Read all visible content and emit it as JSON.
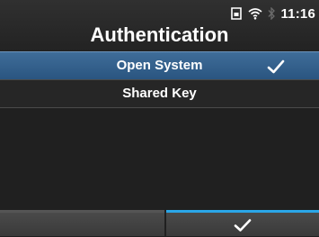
{
  "status_bar": {
    "time": "11:16",
    "icons": [
      "sd-card-icon",
      "wifi-icon",
      "bluetooth-icon"
    ]
  },
  "page": {
    "title": "Authentication"
  },
  "options": [
    {
      "label": "Open System",
      "selected": true
    },
    {
      "label": "Shared Key",
      "selected": false
    }
  ],
  "softkeys": {
    "left": {
      "icon": ""
    },
    "right": {
      "icon": "confirm-check-icon"
    }
  },
  "colors": {
    "selection": "#2f5d8a",
    "accent": "#2aa6e8",
    "background": "#202020"
  }
}
